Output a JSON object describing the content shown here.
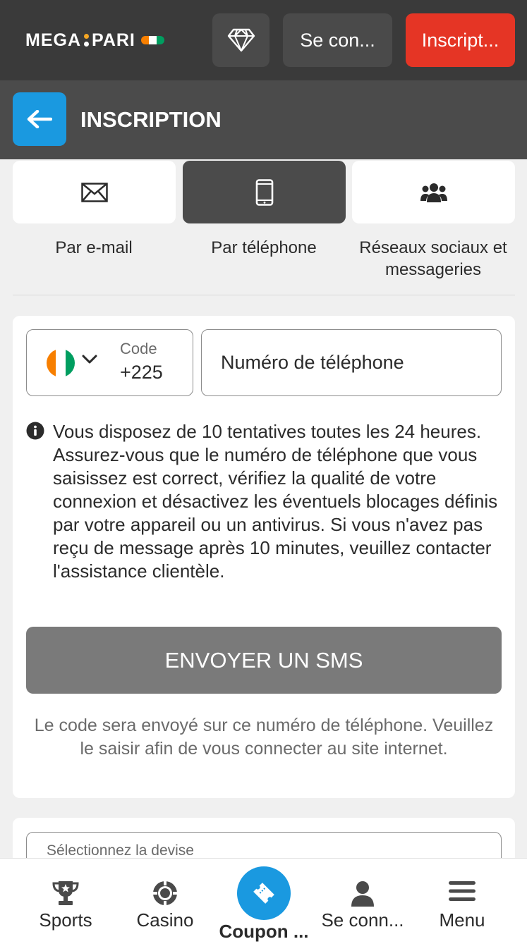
{
  "header": {
    "logo_left": "MEGA",
    "logo_right": "PARI",
    "login_label": "Se con...",
    "register_label": "Inscript...",
    "colors": {
      "bar": "#3a3a3a",
      "register": "#e53525"
    }
  },
  "subheader": {
    "title": "INSCRIPTION",
    "back_icon": "arrow-left-icon",
    "accent": "#1a99e0"
  },
  "methods": [
    {
      "label": "Par e-mail",
      "icon": "envelope-icon",
      "active": false
    },
    {
      "label": "Par téléphone",
      "icon": "mobile-phone-icon",
      "active": true
    },
    {
      "label": "Réseaux sociaux et messageries",
      "icon": "users-icon",
      "active": false
    }
  ],
  "phone_form": {
    "code_label": "Code",
    "code_value": "+225",
    "country_flag": "cote-divoire-flag",
    "phone_placeholder": "Numéro de téléphone",
    "info_text": "Vous disposez de 10 tentatives toutes les 24 heures. Assurez-vous que le numéro de téléphone que vous saisissez est correct, vérifiez la qualité de votre connexion et désactivez les éventuels blocages définis par votre appareil ou un antivirus. Si vous n'avez pas reçu de message après 10 minutes, veuillez contacter l'assistance clientèle.",
    "send_button": "ENVOYER UN SMS",
    "note": "Le code sera envoyé sur ce numéro de téléphone. Veuillez le saisir afin de vous connecter au site internet."
  },
  "currency": {
    "label": "Sélectionnez la devise"
  },
  "bottom_nav": {
    "sports": "Sports",
    "casino": "Casino",
    "coupon": "Coupon ...",
    "login": "Se conn...",
    "menu": "Menu"
  }
}
